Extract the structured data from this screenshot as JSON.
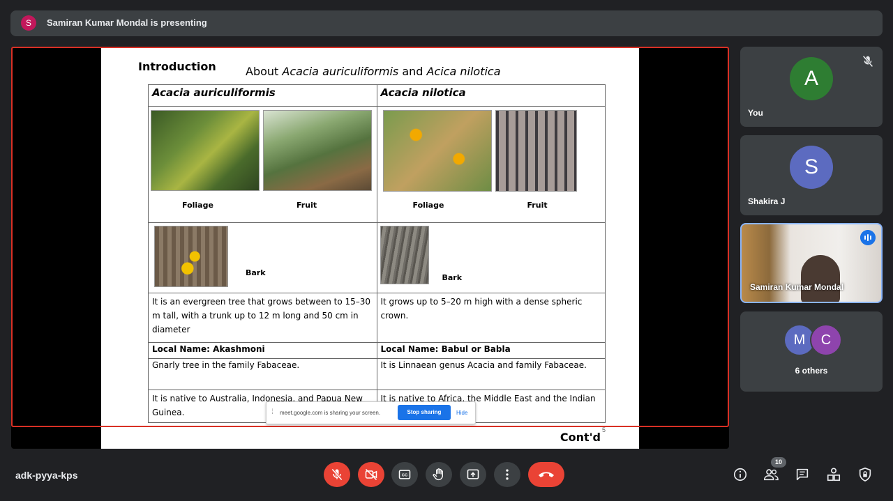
{
  "topbar": {
    "avatar_letter": "S",
    "presenting_text": "Samiran Kumar Mondal is presenting"
  },
  "slide": {
    "intro": "Introduction",
    "heading_prefix": "About ",
    "heading_species1": "Acacia auriculiformis",
    "heading_and": " and ",
    "heading_species2": "Acica nilotica",
    "col1_header": "Acacia auriculiformis",
    "col2_header": "Acacia nilotica",
    "captions": {
      "foliage": "Foliage",
      "fruit": "Fruit",
      "bark": "Bark"
    },
    "col1_desc": "It is an evergreen tree that grows between to 15–30 m tall, with a trunk up to 12 m long and 50 cm in diameter",
    "col2_desc": "It grows up to 5–20 m high with a dense spheric crown.",
    "col1_local": "Local Name: Akashmoni",
    "col2_local": "Local Name: Babul or Babla",
    "col1_family": "Gnarly tree in the family Fabaceae.",
    "col2_family": "It is Linnaean genus Acacia and family Fabaceae.",
    "col1_native": "It is native to Australia, Indonesia, and Papua New Guinea.",
    "col2_native": "It is native to Africa, the Middle East and the Indian",
    "contd": "Cont'd",
    "page_number": "5"
  },
  "share_bar": {
    "message": "meet.google.com is sharing your screen.",
    "stop_label": "Stop sharing",
    "hide_label": "Hide"
  },
  "participants": [
    {
      "letter": "A",
      "name": "You",
      "color": "#2e7d32"
    },
    {
      "letter": "S",
      "name": "Shakira J",
      "color": "#5c6bc0"
    },
    {
      "name": "Samiran Kumar Mondal"
    },
    {
      "letters": [
        "M",
        "C"
      ],
      "name": "6 others",
      "colors": [
        "#5c6bc0",
        "#8e44ad"
      ]
    }
  ],
  "bottombar": {
    "meeting_code": "adk-pyya-kps",
    "people_count": "10"
  }
}
